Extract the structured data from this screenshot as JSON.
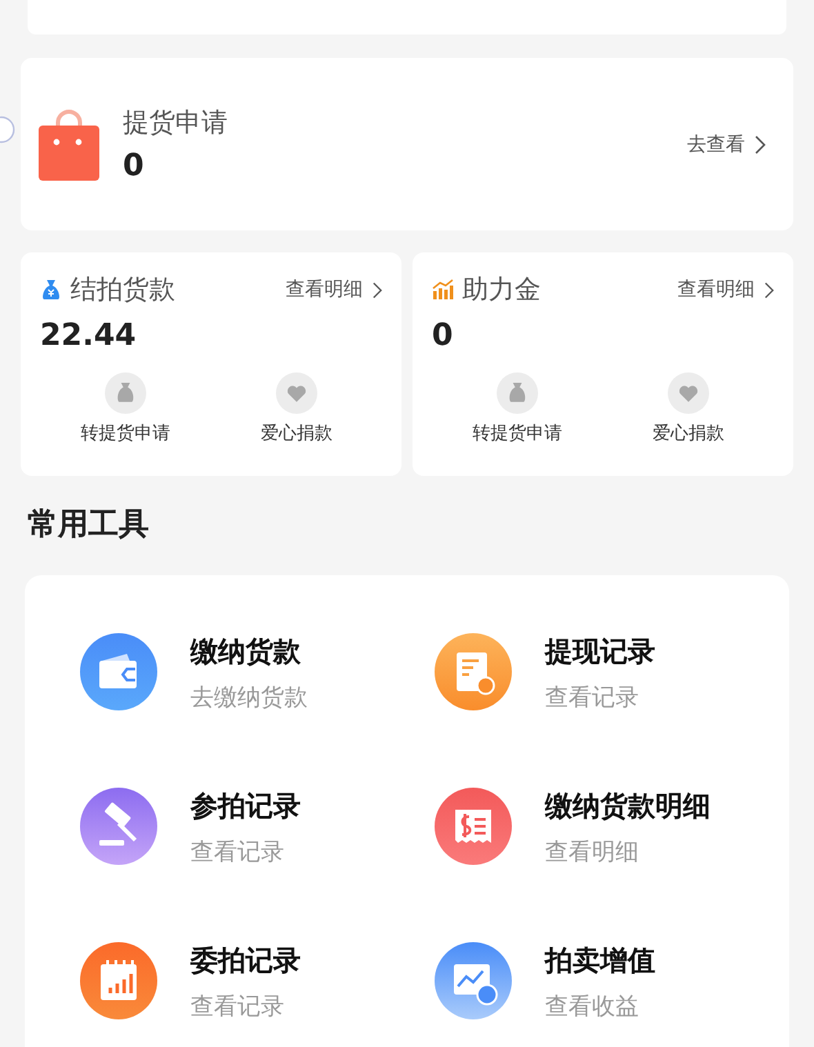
{
  "pickup": {
    "title": "提货申请",
    "value": "0",
    "link": "去查看"
  },
  "funds": [
    {
      "kind": "moneybag",
      "title": "结拍货款",
      "value": "22.44",
      "link": "查看明细",
      "actions": [
        {
          "kind": "bag",
          "label": "转提货申请"
        },
        {
          "kind": "heart",
          "label": "爱心捐款"
        }
      ]
    },
    {
      "kind": "bars",
      "title": "助力金",
      "value": "0",
      "link": "查看明细",
      "actions": [
        {
          "kind": "bag",
          "label": "转提货申请"
        },
        {
          "kind": "heart",
          "label": "爱心捐款"
        }
      ]
    }
  ],
  "tools_title": "常用工具",
  "tools": [
    {
      "kind": "wallet",
      "title": "缴纳货款",
      "subtitle": "去缴纳货款"
    },
    {
      "kind": "receipt",
      "title": "提现记录",
      "subtitle": "查看记录"
    },
    {
      "kind": "gavel",
      "title": "参拍记录",
      "subtitle": "查看记录"
    },
    {
      "kind": "bill",
      "title": "缴纳货款明细",
      "subtitle": "查看明细"
    },
    {
      "kind": "calendar",
      "title": "委拍记录",
      "subtitle": "查看记录"
    },
    {
      "kind": "growth",
      "title": "拍卖增值",
      "subtitle": "查看收益"
    }
  ]
}
